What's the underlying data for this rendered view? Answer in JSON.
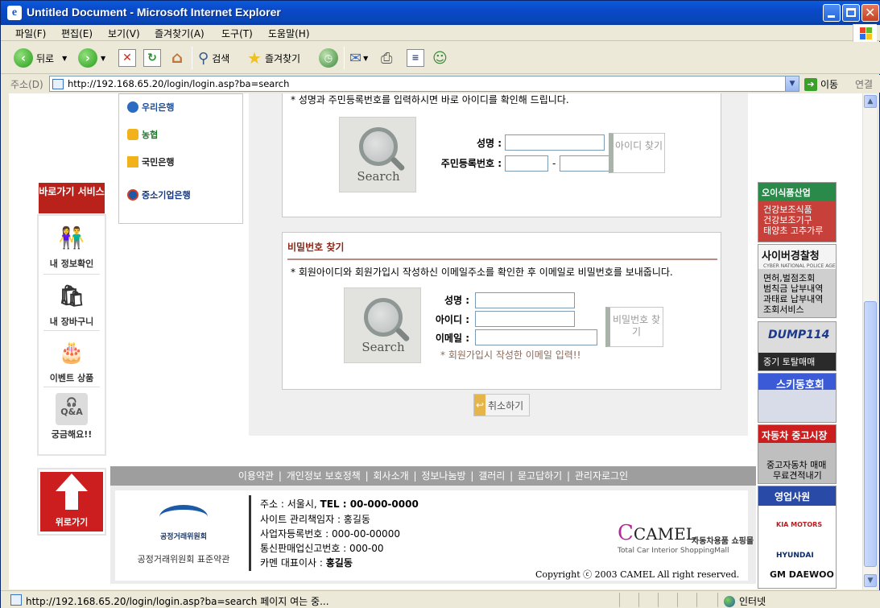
{
  "window": {
    "title": "Untitled Document - Microsoft Internet Explorer"
  },
  "menu": [
    "파일(F)",
    "편집(E)",
    "보기(V)",
    "즐겨찾기(A)",
    "도구(T)",
    "도움말(H)"
  ],
  "toolbar": {
    "back": "뒤로",
    "search": "검색",
    "favorites": "즐겨찾기"
  },
  "address": {
    "label": "주소(D)",
    "url": "http://192.168.65.20/login/login.asp?ba=search",
    "go": "이동",
    "links": "연결"
  },
  "banks": [
    "우리은행",
    "농협",
    "국민은행",
    "중소기업은행"
  ],
  "quick": {
    "header": "바로가기 서비스",
    "items": [
      "내 정보확인",
      "내 장바구니",
      "이벤트 상품",
      "궁금해요!!"
    ],
    "qa_text": "Q&A",
    "top": "위로가기"
  },
  "find_id": {
    "hint": "* 성명과 주민등록번호를 입력하시면 바로 아이디를 확인해 드립니다.",
    "search_caption": "Search",
    "name_label": "성명 :",
    "ssn_label": "주민등록번호 :",
    "ssn_dash": "-",
    "button": "아이디 찾기"
  },
  "find_pw": {
    "title": "비밀번호 찾기",
    "hint": "* 회원아이디와 회원가입시 작성하신 이메일주소를 확인한 후 이메일로 비밀번호를 보내줍니다.",
    "search_caption": "Search",
    "name_label": "성명 :",
    "id_label": "아이디 :",
    "email_label": "이메일 :",
    "note": "* 회원가입시 작성한 이메일 입력!!",
    "button": "비밀번호 찾기"
  },
  "cancel": "취소하기",
  "footer": {
    "links": [
      "이용약관",
      "개인정보 보호정책",
      "회사소개",
      "정보나눔방",
      "갤러리",
      "묻고답하기",
      "관리자로그인"
    ],
    "ftc_name": "공정거래위원회",
    "ftc_sub": "공정거래위원회 표준약관",
    "address_label": "주소 : 서울시,",
    "tel": "TEL : 00-000-0000",
    "manager": "사이트 관리책임자 : 홍길동",
    "biz_no": "사업자등록번호 : 000-00-00000",
    "mail_order": "통신판매업신고번호 : 000-00",
    "ceo_label": "카멘 대표이사 :",
    "ceo": "홍길동",
    "brand": "CAMEL",
    "brand_kor": "자동차용품 쇼핑몰",
    "brand_eng": "Total Car Interior ShoppingMall",
    "copyright": "Copyright ⓒ 2003 CAMEL All right reserved."
  },
  "ads": {
    "a1": {
      "title": "오이식품산업",
      "lines": [
        "건강보조식품",
        "건강보조기구",
        "태양초 고추가루"
      ]
    },
    "a2": {
      "title": "사이버경찰청",
      "sub": "CYBER NATIONAL POLICE AGENCY",
      "lines": [
        "면허,벌점조회",
        "범칙금 납부내역",
        "과태료 납부내역",
        "조회서비스"
      ]
    },
    "a3": {
      "title": "DUMP114",
      "lines": [
        "중기 토탈매매"
      ]
    },
    "a4": {
      "title": "스키동호회"
    },
    "a5": {
      "title": "자동차 중고시장",
      "lines": [
        "중고자동차 매매",
        "무료견적내기"
      ]
    },
    "a6": {
      "title": "영업사원",
      "brands": [
        "KIA MOTORS",
        "HYUNDAI",
        "GM DAEWOO"
      ]
    }
  },
  "status": {
    "text": "http://192.168.65.20/login/login.asp?ba=search 페이지 여는 중...",
    "zone": "인터넷"
  }
}
